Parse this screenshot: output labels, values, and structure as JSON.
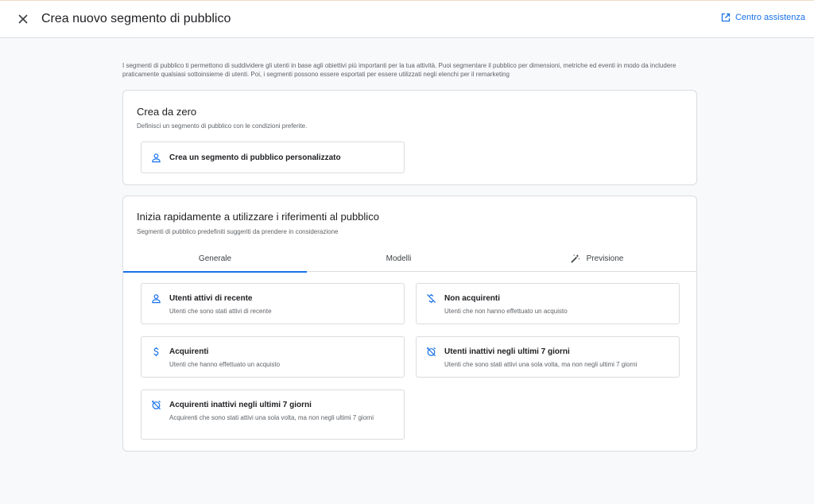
{
  "header": {
    "title": "Crea nuovo segmento di pubblico",
    "help_label": "Centro assistenza",
    "close_icon": "close-icon",
    "help_icon": "open-in-new-icon"
  },
  "intro": "I segmenti di pubblico ti permettono di suddividere gli utenti in base agli obiettivi più importanti per la tua attività. Puoi segmentare il pubblico per dimensioni, metriche ed eventi in modo da includere praticamente qualsiasi sottoinsieme di utenti. Poi, i segmenti possono essere esportati per essere utilizzati negli elenchi per il remarketing",
  "scratch": {
    "title": "Crea da zero",
    "subtitle": "Definisci un segmento di pubblico con le condizioni preferite.",
    "button_label": "Crea un segmento di pubblico personalizzato",
    "button_icon": "person-icon"
  },
  "references": {
    "title": "Inizia rapidamente a utilizzare i riferimenti al pubblico",
    "subtitle": "Segmenti di pubblico predefiniti suggeriti da prendere in considerazione",
    "tabs": [
      {
        "label": "Generale",
        "active": true
      },
      {
        "label": "Modelli",
        "active": false
      },
      {
        "label": "Previsione",
        "active": false,
        "icon": "magic-wand-icon"
      }
    ],
    "items": [
      {
        "title": "Utenti attivi di recente",
        "description": "Utenti che sono stati attivi di recente",
        "icon": "person-icon"
      },
      {
        "title": "Non acquirenti",
        "description": "Utenti che non hanno effettuato un acquisto",
        "icon": "no-money-icon"
      },
      {
        "title": "Acquirenti",
        "description": "Utenti che hanno effettuato un acquisto",
        "icon": "dollar-icon"
      },
      {
        "title": "Utenti inattivi negli ultimi 7 giorni",
        "description": "Utenti che sono stati attivi una sola volta, ma non negli ultimi 7 giorni",
        "icon": "alarm-off-icon"
      },
      {
        "title": "Acquirenti inattivi negli ultimi 7 giorni",
        "description": "Acquirenti che sono stati attivi una sola volta, ma non negli ultimi 7 giorni",
        "icon": "alarm-off-icon"
      }
    ]
  },
  "colors": {
    "accent": "#1a73e8",
    "text": "#202124",
    "muted": "#5f6368",
    "border": "#dadce0",
    "background": "#f8f9fa"
  }
}
